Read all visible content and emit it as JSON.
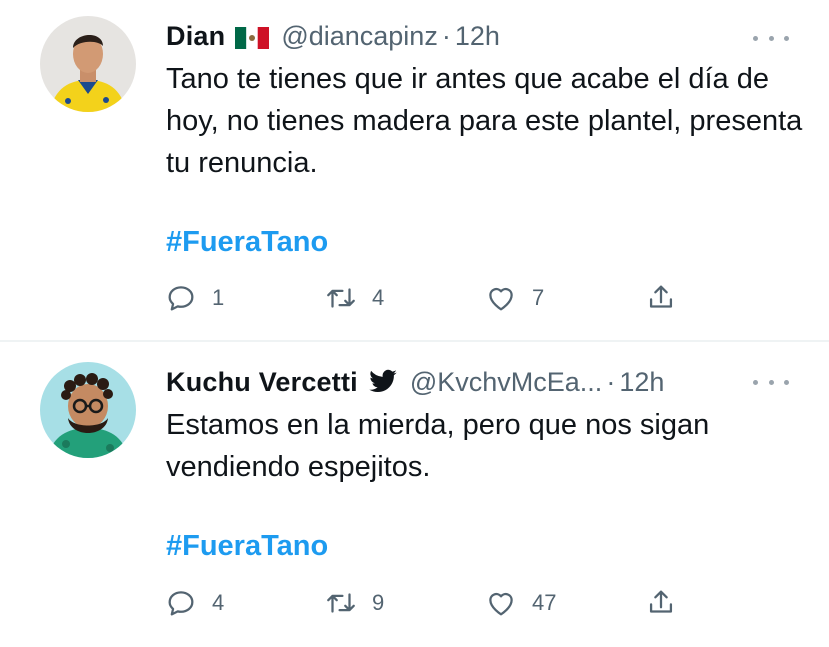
{
  "tweets": [
    {
      "name": "Dian",
      "flag_icon": "mexico-flag-icon",
      "handle": "@diancapinz",
      "separator": "·",
      "time": "12h",
      "text": "Tano te tienes que ir antes que acabe el día de hoy, no tienes madera para este plantel, presenta tu renuncia.",
      "hashtag": "#FueraTano",
      "replies": "1",
      "retweets": "4",
      "likes": "7"
    },
    {
      "name": "Kuchu Vercetti",
      "bird_icon": "twitter-bird-icon",
      "handle": "@KvchvMcEa...",
      "separator": "·",
      "time": "12h",
      "text": "Estamos en la mierda, pero que nos sigan vendiendo espejitos.",
      "hashtag": "#FueraTano",
      "replies": "4",
      "retweets": "9",
      "likes": "47"
    }
  ],
  "colors": {
    "text": "#0f1419",
    "secondary": "#536471",
    "link": "#1d9bf0",
    "divider": "#eff3f4"
  }
}
